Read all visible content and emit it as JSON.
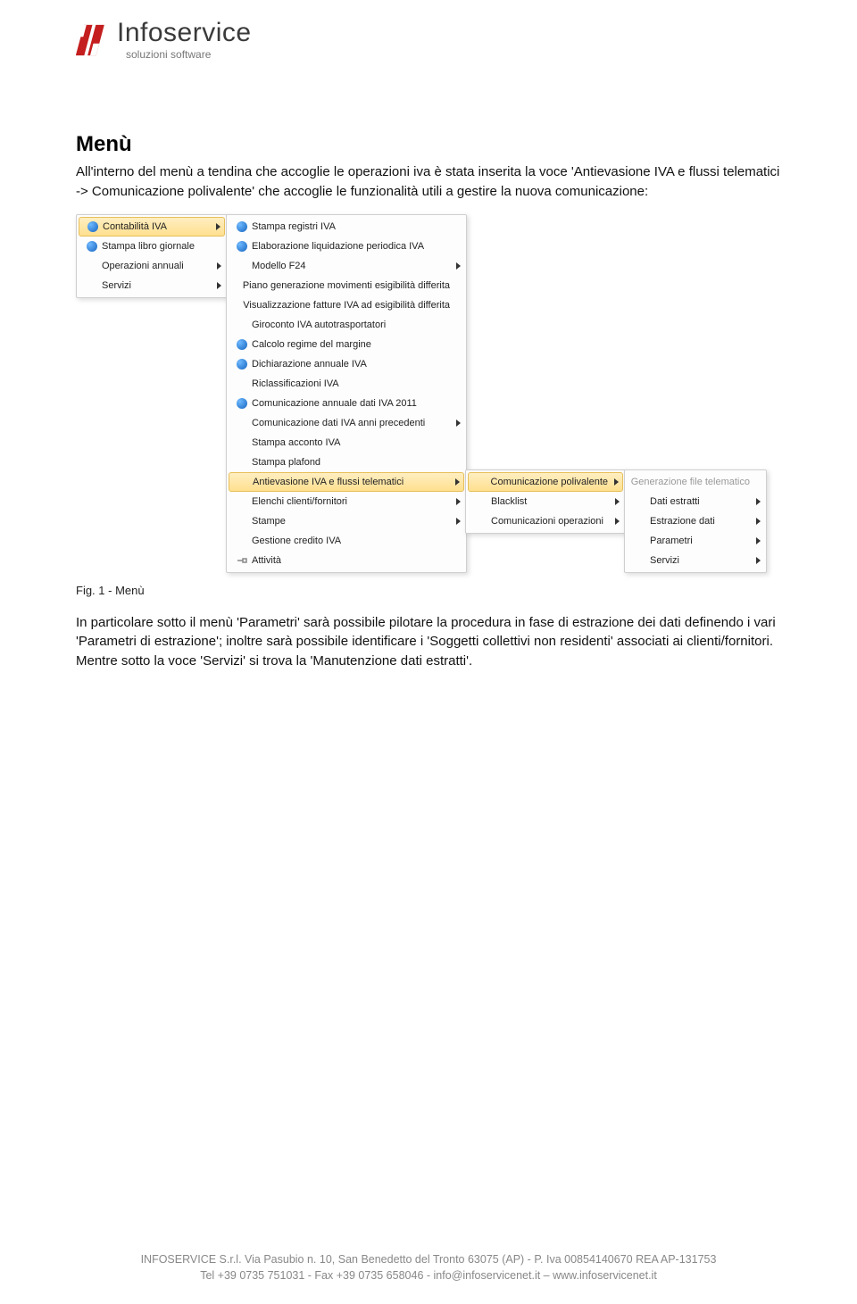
{
  "logo": {
    "title": "Infoservice",
    "subtitle": "soluzioni software"
  },
  "heading": "Menù",
  "para1": "All'interno del menù a tendina che accoglie le operazioni iva è stata inserita la voce 'Antievasione IVA e flussi telematici -> Comunicazione polivalente' che accoglie le funzionalità utili a gestire la nuova comunicazione:",
  "caption": "Fig. 1 - Menù",
  "para2": "In particolare sotto il menù 'Parametri' sarà possibile pilotare la procedura in fase di estrazione dei dati definendo i vari 'Parametri di estrazione'; inoltre sarà possibile identificare i 'Soggetti collettivi non residenti' associati ai clienti/fornitori. Mentre sotto la voce 'Servizi' si trova la 'Manutenzione dati estratti'.",
  "menus": {
    "col1": [
      {
        "label": "Contabilità IVA",
        "icon": "globe",
        "hl": true,
        "sub": true
      },
      {
        "label": "Stampa libro giornale",
        "icon": "globe"
      },
      {
        "label": "Operazioni annuali",
        "sub": true
      },
      {
        "label": "Servizi",
        "sub": true
      }
    ],
    "col2": [
      {
        "label": "Stampa registri IVA",
        "icon": "globe"
      },
      {
        "label": "Elaborazione liquidazione periodica IVA",
        "icon": "globe"
      },
      {
        "label": "Modello F24",
        "sub": true
      },
      {
        "label": "Piano generazione movimenti esigibilità differita"
      },
      {
        "label": "Visualizzazione fatture IVA ad esigibilità differita"
      },
      {
        "label": "Giroconto IVA autotrasportatori"
      },
      {
        "label": "Calcolo regime del margine",
        "icon": "globe"
      },
      {
        "label": "Dichiarazione annuale IVA",
        "icon": "globe"
      },
      {
        "label": "Riclassificazioni IVA"
      },
      {
        "label": "Comunicazione annuale dati IVA 2011",
        "icon": "globe"
      },
      {
        "label": "Comunicazione dati IVA anni precedenti",
        "sub": true
      },
      {
        "label": "Stampa acconto IVA"
      },
      {
        "label": "Stampa plafond"
      },
      {
        "label": "Antievasione IVA e flussi telematici",
        "hl": true,
        "sub": true
      },
      {
        "label": "Elenchi clienti/fornitori",
        "sub": true
      },
      {
        "label": "Stampe",
        "sub": true
      },
      {
        "label": "Gestione credito IVA"
      },
      {
        "label": "Attività",
        "icon": "key"
      }
    ],
    "col3": [
      {
        "label": "Comunicazione polivalente",
        "hl": true,
        "sub": true
      },
      {
        "label": "Blacklist",
        "sub": true
      },
      {
        "label": "Comunicazioni operazioni",
        "sub": true
      }
    ],
    "col4": [
      {
        "label": "Generazione file telematico",
        "disabled": true
      },
      {
        "label": "Dati estratti",
        "sub": true
      },
      {
        "label": "Estrazione dati",
        "sub": true
      },
      {
        "label": "Parametri",
        "sub": true
      },
      {
        "label": "Servizi",
        "sub": true
      }
    ]
  },
  "footer": {
    "line1": "INFOSERVICE S.r.l. Via Pasubio n. 10, San Benedetto del Tronto 63075 (AP) - P. Iva 00854140670 REA AP-131753",
    "line2": "Tel +39 0735 751031 - Fax +39 0735 658046 - info@infoservicenet.it – www.infoservicenet.it"
  }
}
